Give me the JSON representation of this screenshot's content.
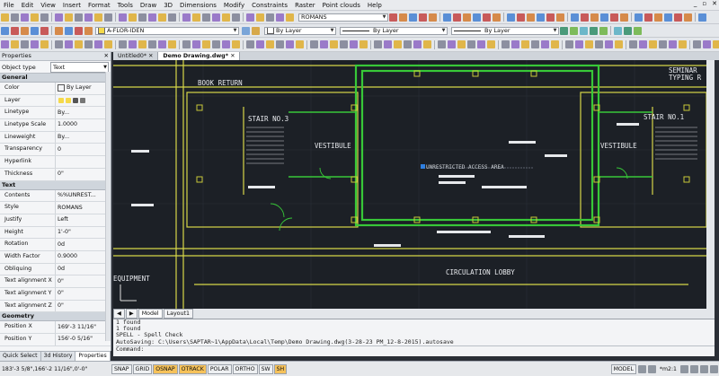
{
  "menu": [
    "File",
    "Edit",
    "View",
    "Insert",
    "Format",
    "Tools",
    "Draw",
    "3D",
    "Dimensions",
    "Modify",
    "Constraints",
    "Raster",
    "Point clouds",
    "Help"
  ],
  "toolbar": {
    "text_style": "ROMANS",
    "layer": "A-FLOR-IDEN",
    "color": "By Layer",
    "linetype": "By Layer",
    "lineweight": "By Layer"
  },
  "properties": {
    "title": "Properties",
    "object_type_label": "Object type",
    "object_type_value": "Text",
    "sections": [
      {
        "name": "General",
        "rows": [
          {
            "k": "Color",
            "v": "By Layer"
          },
          {
            "k": "Layer",
            "v": ""
          },
          {
            "k": "Linetype",
            "v": "By..."
          },
          {
            "k": "Linetype Scale",
            "v": "1.0000"
          },
          {
            "k": "Lineweight",
            "v": "By..."
          },
          {
            "k": "Transparency",
            "v": "0"
          },
          {
            "k": "Hyperlink",
            "v": ""
          },
          {
            "k": "Thickness",
            "v": "0\""
          }
        ]
      },
      {
        "name": "Text",
        "rows": [
          {
            "k": "Contents",
            "v": "%%UNREST..."
          },
          {
            "k": "Style",
            "v": "ROMANS"
          },
          {
            "k": "Justify",
            "v": "Left"
          },
          {
            "k": "Height",
            "v": "1'-0\""
          },
          {
            "k": "Rotation",
            "v": "0d"
          },
          {
            "k": "Width Factor",
            "v": "0.9000"
          },
          {
            "k": "Obliquing",
            "v": "0d"
          },
          {
            "k": "Text alignment X",
            "v": "0\""
          },
          {
            "k": "Text alignment Y",
            "v": "0\""
          },
          {
            "k": "Text alignment Z",
            "v": "0\""
          }
        ]
      },
      {
        "name": "Geometry",
        "rows": [
          {
            "k": "Position X",
            "v": "169'-3 11/16\""
          },
          {
            "k": "Position Y",
            "v": "156'-0 5/16\""
          }
        ]
      }
    ]
  },
  "panel_tabs": [
    "Quick Select",
    "3d History",
    "Properties"
  ],
  "doc_tabs": [
    "Untitled0*",
    "Demo Drawing.dwg*"
  ],
  "layout_tabs": [
    "Model",
    "Layout1"
  ],
  "drawing_labels": {
    "book_return": "BOOK RETURN",
    "stair1": "STAIR NO.3",
    "stair2": "STAIR NO.1",
    "vestibule1": "VESTIBULE",
    "vestibule2": "VESTIBULE",
    "seminar": "SEMINAR",
    "typing": "TYPING R",
    "lobby": "CIRCULATION LOBBY",
    "equip": "EQUIPMENT",
    "selected_text": "UNRESTRICTED ACCESS AREA"
  },
  "command_lines": [
    "1 found",
    "1 found",
    "SPELL - Spell Check",
    "AutoSaving: C:\\Users\\SAPTAR~1\\AppData\\Local\\Temp\\Demo Drawing.dwg(3-28-23 PM_12-8-2015).autosave"
  ],
  "command_prompt": "Command:",
  "status": {
    "coords": "183'-3 5/8\",166'-2 11/16\",0'-0\"",
    "buttons": [
      "SNAP",
      "GRID",
      "OSNAP",
      "OTRACK",
      "POLAR",
      "ORTHO",
      "SW",
      "SH"
    ],
    "on": [
      "OSNAP",
      "OTRACK",
      "SH"
    ],
    "model": "MODEL",
    "scale": "*m2:1"
  }
}
